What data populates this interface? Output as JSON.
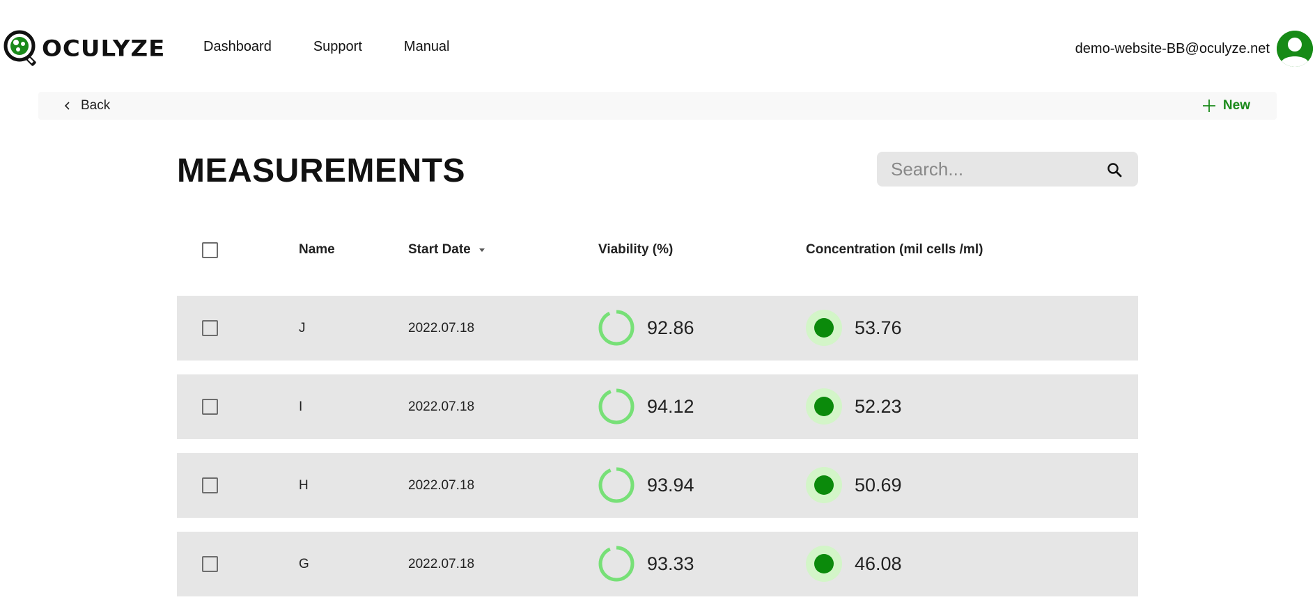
{
  "brand": {
    "name": "OCULYZE"
  },
  "nav": {
    "items": [
      {
        "label": "Dashboard"
      },
      {
        "label": "Support"
      },
      {
        "label": "Manual"
      }
    ]
  },
  "user": {
    "email": "demo-website-BB@oculyze.net"
  },
  "actions": {
    "back_label": "Back",
    "new_label": "New"
  },
  "page": {
    "title": "MEASUREMENTS"
  },
  "search": {
    "placeholder": "Search...",
    "value": ""
  },
  "table": {
    "columns": {
      "name": "Name",
      "start_date": "Start Date",
      "viability": "Viability (%)",
      "concentration": "Concentration (mil cells /ml)"
    },
    "sort": {
      "column": "start_date",
      "direction": "descending"
    },
    "rows": [
      {
        "name": "J",
        "start_date": "2022.07.18",
        "viability": "92.86",
        "concentration": "53.76"
      },
      {
        "name": "I",
        "start_date": "2022.07.18",
        "viability": "94.12",
        "concentration": "52.23"
      },
      {
        "name": "H",
        "start_date": "2022.07.18",
        "viability": "93.94",
        "concentration": "50.69"
      },
      {
        "name": "G",
        "start_date": "2022.07.18",
        "viability": "93.33",
        "concentration": "46.08"
      }
    ]
  },
  "colors": {
    "brand_green": "#1a8a1a",
    "ring_green": "#77e077",
    "dot_green": "#0b8a0b",
    "dot_halo": "#d3f5c8",
    "row_bg": "#e6e6e6"
  }
}
